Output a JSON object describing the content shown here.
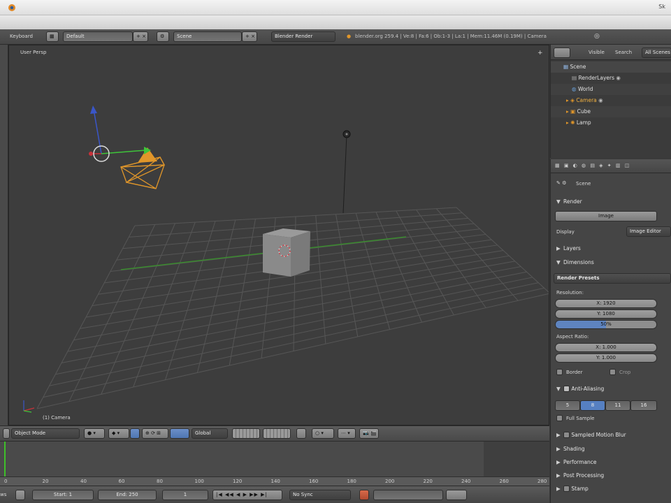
{
  "titlebar": {
    "controls": "Sk"
  },
  "info_header": {
    "editor_label": "Keyboard",
    "screen_layout": "Default",
    "scene": "Scene",
    "render_engine": "Blender Render",
    "stats": "blender.org 259.4 | Ve:8 | Fa:6 | Ob:1-3 | La:1 | Mem:11.46M (0.19M) | Camera"
  },
  "viewport": {
    "view_name": "User Persp",
    "object_label": "(1) Camera"
  },
  "viewport_header": {
    "mode": "Object Mode",
    "transform_orientation": "Global"
  },
  "timeline": {
    "ruler_ticks": [
      "0",
      "20",
      "40",
      "60",
      "80",
      "100",
      "120",
      "140",
      "160",
      "180",
      "200",
      "220",
      "240",
      "260",
      "280"
    ],
    "start_label": "Start: 1",
    "end_label": "End: 250",
    "current_frame": "1",
    "sync": "No Sync"
  },
  "outliner": {
    "tabs": [
      "Visible",
      "Search",
      "All Scenes"
    ],
    "items": [
      {
        "label": "Scene"
      },
      {
        "label": "RenderLayers"
      },
      {
        "label": "World"
      },
      {
        "label": "Camera"
      },
      {
        "label": "Cube"
      },
      {
        "label": "Lamp"
      }
    ]
  },
  "properties": {
    "context": "Scene",
    "render_panel": "Render",
    "image_button": "Image",
    "display_label": "Display",
    "display_value": "Image Editor",
    "layers_panel": "Layers",
    "dimensions_panel": "Dimensions",
    "render_presets": "Render Presets",
    "resolution_label": "Resolution:",
    "res_x": "X: 1920",
    "res_y": "Y: 1080",
    "res_pct": "50%",
    "aspect_label": "Aspect Ratio:",
    "aspect_x": "X: 1.000",
    "aspect_y": "Y: 1.000",
    "border_label": "Border",
    "crop_label": "Crop",
    "antialiasing_label": "Anti-Aliasing",
    "aa_samples": [
      "5",
      "8",
      "11",
      "16"
    ],
    "full_sample": "Full Sample",
    "motion_blur": "Sampled Motion Blur",
    "shading": "Shading",
    "performance": "Performance",
    "post_processing": "Post Processing",
    "stamp": "Stamp"
  },
  "colors": {
    "viewport_bg": "#3d3d3d",
    "grid": "#505050",
    "x_axis": "#3a8a2e",
    "camera": "#e0962a",
    "selected_aa": "#5680c2"
  }
}
